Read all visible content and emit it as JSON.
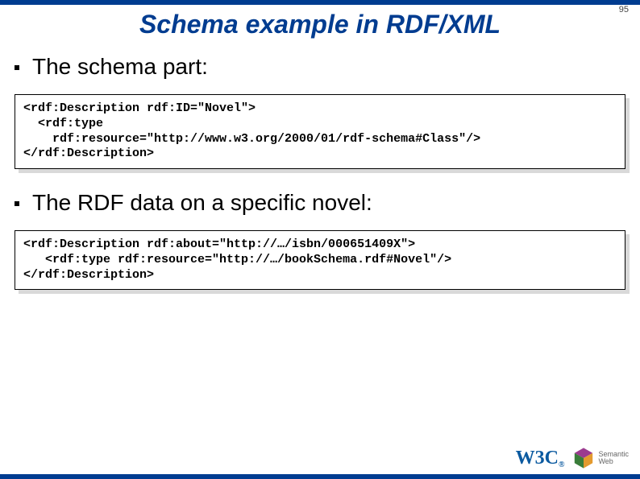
{
  "slide": {
    "number": "95",
    "title": "Schema example in RDF/XML"
  },
  "bullets": {
    "first": "The schema part:",
    "second": "The RDF data on a specific novel:"
  },
  "code": {
    "block1": "<rdf:Description rdf:ID=\"Novel\">\n  <rdf:type\n    rdf:resource=\"http://www.w3.org/2000/01/rdf-schema#Class\"/>\n</rdf:Description>",
    "block2": "<rdf:Description rdf:about=\"http://…/isbn/000651409X\">\n   <rdf:type rdf:resource=\"http://…/bookSchema.rdf#Novel\"/>\n</rdf:Description>"
  },
  "logos": {
    "w3c": "W3C",
    "sw_line1": "Semantic",
    "sw_line2": "Web"
  }
}
